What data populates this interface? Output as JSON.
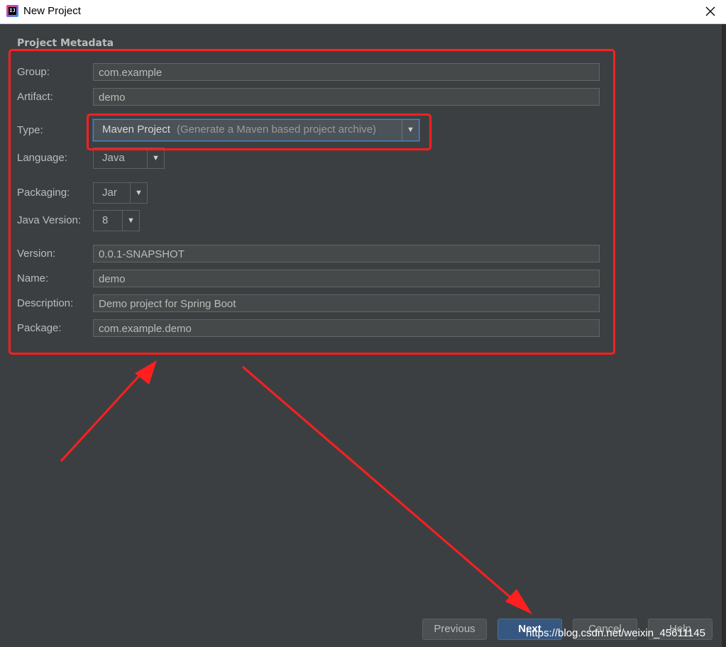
{
  "window": {
    "title": "New Project",
    "icon": "intellij-idea-icon",
    "close_icon": "close-icon"
  },
  "section_title": "Project Metadata",
  "fields": {
    "group": {
      "label": "Group:",
      "value": "com.example"
    },
    "artifact": {
      "label": "Artifact:",
      "value": "demo"
    },
    "version": {
      "label": "Version:",
      "value": "0.0.1-SNAPSHOT"
    },
    "name": {
      "label": "Name:",
      "value": "demo"
    },
    "description": {
      "label": "Description:",
      "value": "Demo project for Spring Boot"
    },
    "package": {
      "label": "Package:",
      "value": "com.example.demo"
    }
  },
  "selects": {
    "type": {
      "label": "Type:",
      "value": "Maven Project",
      "hint": "(Generate a Maven based project archive)"
    },
    "language": {
      "label": "Language:",
      "value": "Java"
    },
    "packaging": {
      "label": "Packaging:",
      "value": "Jar"
    },
    "java_version": {
      "label": "Java Version:",
      "value": "8"
    }
  },
  "dropdown_arrow_glyph": "▼",
  "buttons": {
    "previous": "Previous",
    "next": "Next",
    "cancel": "Cancel",
    "help": "Help"
  },
  "annotations": {
    "highlight_color": "#ff1f1f"
  },
  "watermark": "https://blog.csdn.net/weixin_45611145",
  "colors": {
    "background": "#3c3f41",
    "field_background": "#45494a",
    "primary_button": "#365880",
    "text": "#bbbbbb"
  }
}
